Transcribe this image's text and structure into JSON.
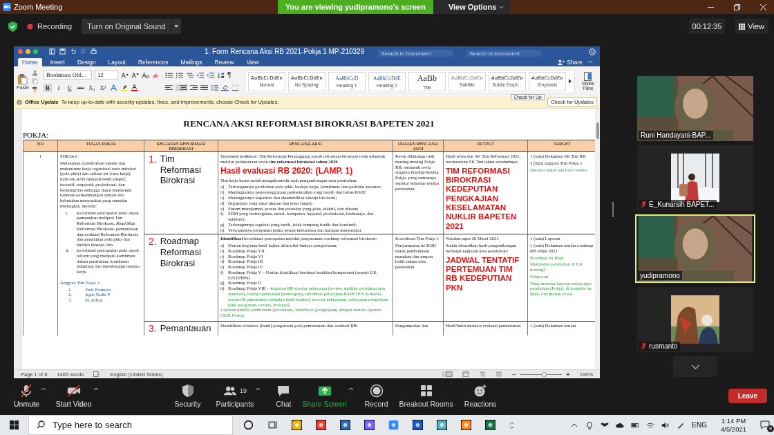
{
  "window": {
    "title": "Zoom Meeting"
  },
  "banner": {
    "text": "You are viewing yudipramono's screen",
    "view_options": "View Options"
  },
  "toolbar": {
    "recording": "Recording",
    "original_sound": "Turn on Original Sound",
    "timer": "00:12:35",
    "view": "View"
  },
  "word": {
    "title": "1. Form Rencana Aksi RB 2021-Pokja 1 MP-210329",
    "search_placeholders": [
      "Search in Document",
      "Search in Document"
    ],
    "tabs": [
      {
        "label": "Home",
        "selected": true
      },
      {
        "label": "Insert",
        "selected": false
      },
      {
        "label": "Design",
        "selected": false
      },
      {
        "label": "Layout",
        "selected": false
      },
      {
        "label": "References",
        "selected": false
      },
      {
        "label": "Mailings",
        "selected": false
      },
      {
        "label": "Review",
        "selected": false
      },
      {
        "label": "View",
        "selected": false
      }
    ],
    "share": "Share",
    "paste": "Paste",
    "font": "Bookman Old...",
    "size": "12",
    "format_buttons": [
      "B",
      "I",
      "U",
      "abc",
      "X₂",
      "X²"
    ],
    "pilcrow": "¶",
    "styles": [
      {
        "preview": "AaBbCcDdEe",
        "name": "Normal"
      },
      {
        "preview": "AaBbCcDdEe",
        "name": "No Spacing"
      },
      {
        "preview": "AaBbCcD",
        "name": "Heading 1"
      },
      {
        "preview": "AaBbCcDdE",
        "name": "Heading 2"
      },
      {
        "preview": "AaBb",
        "name": "Title"
      },
      {
        "preview": "AaBbCcDdEe",
        "name": "Subtitle"
      },
      {
        "preview": "AaBbCcDdEe",
        "name": "Subtle Emph..."
      },
      {
        "preview": "AaBbCcDdEe",
        "name": "Emphasis"
      }
    ],
    "styles_pane": "Styles Pane",
    "update": {
      "title": "Office Update",
      "message": "To keep up-to-date with security updates, fixes, and improvements, choose Check for Updates.",
      "button": "Check for Updates",
      "tooltip": "Check for Up"
    },
    "status": {
      "page": "Page 1 of 8",
      "words": "1465 words",
      "language": "English (United States)",
      "zoom": "190%",
      "zoom_out": "−",
      "zoom_in": "+",
      "level": 0.58
    }
  },
  "doc": {
    "title": "RENCANA AKSI REFORMASI BIROKRASI BAPETEN 2021",
    "label": "POKJA:",
    "columns": [
      "NO",
      "TUGAS POKJA",
      "KEGIATAN REFORMASI BIROKRASI",
      "RENCANA AKSI",
      "URAIAN RENCANA AKSI",
      "OUTPUT",
      "TARGET"
    ],
    "no": "1",
    "tugas": [
      {
        "kind": "p",
        "text": "POKJA I:"
      },
      {
        "kind": "p",
        "text": "Melakukan transformasi sistem dan mekanisme kerja organisasi serta mindset (pola pikir) dan culture set (cara kerja) individu ASN menjadi lebih adaptif, inovatif, responsif, profesional, dan berintegritas sehingga dapat memenuhi tuntutan perkembangan zaman dan kebutuhan masyarakat yang semakin meningkat, melalui:"
      },
      {
        "kind": "sublist",
        "items": [
          {
            "label": "i.",
            "text": "koordinasi pencapaian pada aspek pemenuhan meliputi Tim Reformasi Birokrasi, *Road Map* Reformasi Birokrasi, pemantauan dan evaluasi Reformasi Birokrasi, dan perubahan pola pikir dan budaya kinerja; dan"
          },
          {
            "label": "ii.",
            "text": "koordinasi pencapaian pada aspek reform yang meliputi komitmen dalam perubahan, komitmen pimpinan dan membangun budaya kerja."
          }
        ]
      },
      {
        "kind": "gap"
      },
      {
        "kind": "blue",
        "text": "Anggota Tim Pokja 1:"
      },
      {
        "kind": "members",
        "items": [
          {
            "label": "1.",
            "text": "Yudi Pramono"
          },
          {
            "label": "2.",
            "text": "Agus Yudhi P"
          },
          {
            "label": "3.",
            "text": "M. Alfian"
          }
        ]
      }
    ],
    "rows": [
      {
        "number": "1.",
        "activity": "Tim Reformasi Birokrasi",
        "rencana": [
          {
            "kind": "p",
            "text": "Terpenuhi indikator: Tim Reformasi/Penanggung jawab reformasi birokrasi telah dibentuk melalui pelaksanaan reviu **tim reformasi birokrasi tahun 2020**."
          },
          {
            "kind": "heading",
            "text": "Hasil evaluasi RB 2020: (LAMP. 1)"
          },
          {
            "kind": "p",
            "text": "Tim kerja harus sudah mengakomodir arah pengembangan area perubahan:"
          },
          {
            "kind": "list",
            "items": [
              {
                "label": "a)",
                "text": "Terbangunnya perubahan pola pikir, budaya kerja, komitmen, dan perilaku aparatur;"
              },
              {
                "label": "b)",
                "text": "Meningkatnya penyelenggaraan pemerintahan yang bersih dan bebas KKN;"
              },
              {
                "label": "c)",
                "text": "Meningkatnya kapasitas dan akuntabilitas kinerja birokrasi;"
              },
              {
                "label": "d)",
                "text": "Organisasi yang tepat ukuran dan tepat fungsi;"
              },
              {
                "label": "e)",
                "text": "Sistem manajemen, proses dan prosedur yang jelas, efektif, dan efisien;"
              },
              {
                "label": "f)",
                "text": "SDM yang berintegritas, netral, kompeten, kapabel, profesional, berkinerja, dan sejahtera;"
              },
              {
                "label": "g)",
                "text": "Terbangunnya regulasi yang tertib, tidak tumpang tindih dan kondusif;"
              },
              {
                "label": "h)",
                "text": "Terwujudnya pelayanan prima sesuai kebutuhan dan harapan masyarakat."
              }
            ]
          }
        ],
        "uraian": [
          {
            "kind": "p",
            "text": "Reviu dilakukan oleh masing-masing Pokja RB, termasuk reviu anggota masing-masing Pokja, yang semuanya sepakat terhadap usulan perubahan."
          }
        ],
        "output": [
          {
            "kind": "p",
            "text": "Hasil reviu dan SK Tim Reformasi 2021, berdasarkan SK Tim tahun sebelumnya."
          },
          {
            "kind": "big",
            "text": "TIM REFORMASI BIROKRASI KEDEPUTIAN PENGKAJIAN KESELAMATAN NUKLIR BAPETEN 2021"
          }
        ],
        "target": [
          {
            "kind": "p",
            "text": "1 (satu) Dokumen SK Tim RB"
          },
          {
            "kind": "p",
            "text": "3 (tiga) anggota Tim Pokja 1"
          },
          {
            "kind": "green",
            "text": "Oktober sudah ada hasil review"
          }
        ]
      },
      {
        "number": "2.",
        "activity": "Roadmap Reformasi Birokrasi",
        "rencana": [
          {
            "kind": "p",
            "text": "**Identifikasi** koordinasi pencapaian melalui penyusunan roadmap reformasi birokrasi:"
          },
          {
            "kind": "list",
            "items": [
              {
                "label": "a)",
                "text": "Usulan kegiatan hasil kajian nilai-nilai budaya pengawasan;"
              },
              {
                "label": "b)",
                "text": "Roadmap Pokja VII"
              },
              {
                "label": "c)",
                "text": "Roadmap Pokja VI"
              },
              {
                "label": "d)",
                "text": "Roadmap Pokja III"
              },
              {
                "label": "e)",
                "text": "Roadmap Pokja IV."
              },
              {
                "label": "f)",
                "text": "Roadmap Pokja V – Usulan klasifikasi berdasar keahlian/kompetensi (seperti UK P2STPIBN)"
              },
              {
                "label": "g)",
                "text": "Roadmap Pokja II"
              },
              {
                "label": "h)",
                "text": "Roadmap Pokja VIII –",
                "note": "kegiatan RB standar pelayanan (review, melihat perbaikan atas standard), budaya pelayanan (penerapan), informasi pelayanan BAPETEN di media, reward & punishment terhadap hasil (sanksi), inovasi pelayanan), pelayanan pengaduan (unit pelayanan, review, evaluasi)."
              }
            ]
          },
          {
            "kind": "green",
            "text": "Layanan publik: pembinaan (peraturan), Justifikasi (pengkajian) dengan standar layanan (SOP, Perka)"
          }
        ],
        "uraian": [
          {
            "kind": "p",
            "text": "Koordinasi Tim Pokja 1"
          },
          {
            "kind": "p",
            "text": "Penyampaian ke BOU untuk pembahasan masukan dan umpan balik semua area perubahan"
          }
        ],
        "output": [
          {
            "kind": "p",
            "text": "Notulen rapat 20 Maret 2021"
          },
          {
            "kind": "p",
            "text": "Sudah disusulkan hasil pengembangan berbagai kegiatan area perubahan:"
          },
          {
            "kind": "big",
            "text": "JADWAL TENTATIF PERTEMUAN TIM RB KEDEPUTIAN PKN"
          }
        ],
        "target": [
          {
            "kind": "p",
            "text": "1 (satu) Laporan"
          },
          {
            "kind": "p",
            "text": "1 (satu) Dokumen usulan roadmap RB tahun 2021"
          },
          {
            "kind": "green",
            "text": "Roadmap bu Runi"
          },
          {
            "kind": "green",
            "text": "Membahas perubahan di UK masing2."
          },
          {
            "kind": "green",
            "text": "Pelaporan"
          },
          {
            "kind": "green",
            "text": "Yang memuat laporan setiap agen perubahan (Pokja), di kompile bu Runi, dan masuk cloud."
          }
        ]
      },
      {
        "number": "3.",
        "activity": "Pemantauan",
        "rencana": [
          {
            "kind": "p",
            "text": "Identifikasi evidence (bukti) pengaturan pola pemantauan dan evaluasi RB:"
          }
        ],
        "uraian": [
          {
            "kind": "p",
            "text": "Pengumpulan dan"
          }
        ],
        "output": [
          {
            "kind": "p",
            "text": "Hasil/bukti monitor evaluasi pemantauan"
          }
        ],
        "target": [
          {
            "kind": "p",
            "text": "1 (satu) Dokumen usulan"
          }
        ]
      }
    ]
  },
  "participants": [
    {
      "name": "Runi Handayani-BAP...",
      "muted": false,
      "selected": false,
      "kind": "video"
    },
    {
      "name": "E_Kunarsih BAPET...",
      "muted": true,
      "selected": false
    },
    {
      "name": "yudipramono",
      "muted": false,
      "selected": true,
      "kind": "video"
    },
    {
      "name": "rusmanto",
      "muted": true,
      "selected": false
    }
  ],
  "controls": [
    {
      "label": "Unmute",
      "off": true,
      "caret": true,
      "highlighted": false
    },
    {
      "label": "Start Video",
      "off": true,
      "caret": true,
      "highlighted": false
    },
    {
      "label": "Security",
      "off": false,
      "caret": false,
      "highlighted": false
    },
    {
      "label": "Participants",
      "off": false,
      "caret": true,
      "count": "19",
      "highlighted": false
    },
    {
      "label": "Chat",
      "off": false,
      "caret": false,
      "highlighted": false
    },
    {
      "label": "Share Screen",
      "off": false,
      "caret": true,
      "highlighted": true
    },
    {
      "label": "Record",
      "off": false,
      "caret": false,
      "highlighted": false
    },
    {
      "label": "Breakout Rooms",
      "off": false,
      "caret": false,
      "highlighted": false
    },
    {
      "label": "Reactions",
      "off": false,
      "caret": false,
      "highlighted": false
    }
  ],
  "leave": "Leave",
  "taskbar": {
    "search_placeholder": "Type here to search",
    "language": "ENG",
    "time": "1:14 PM",
    "date": "4/5/2021",
    "notifications": "9"
  }
}
